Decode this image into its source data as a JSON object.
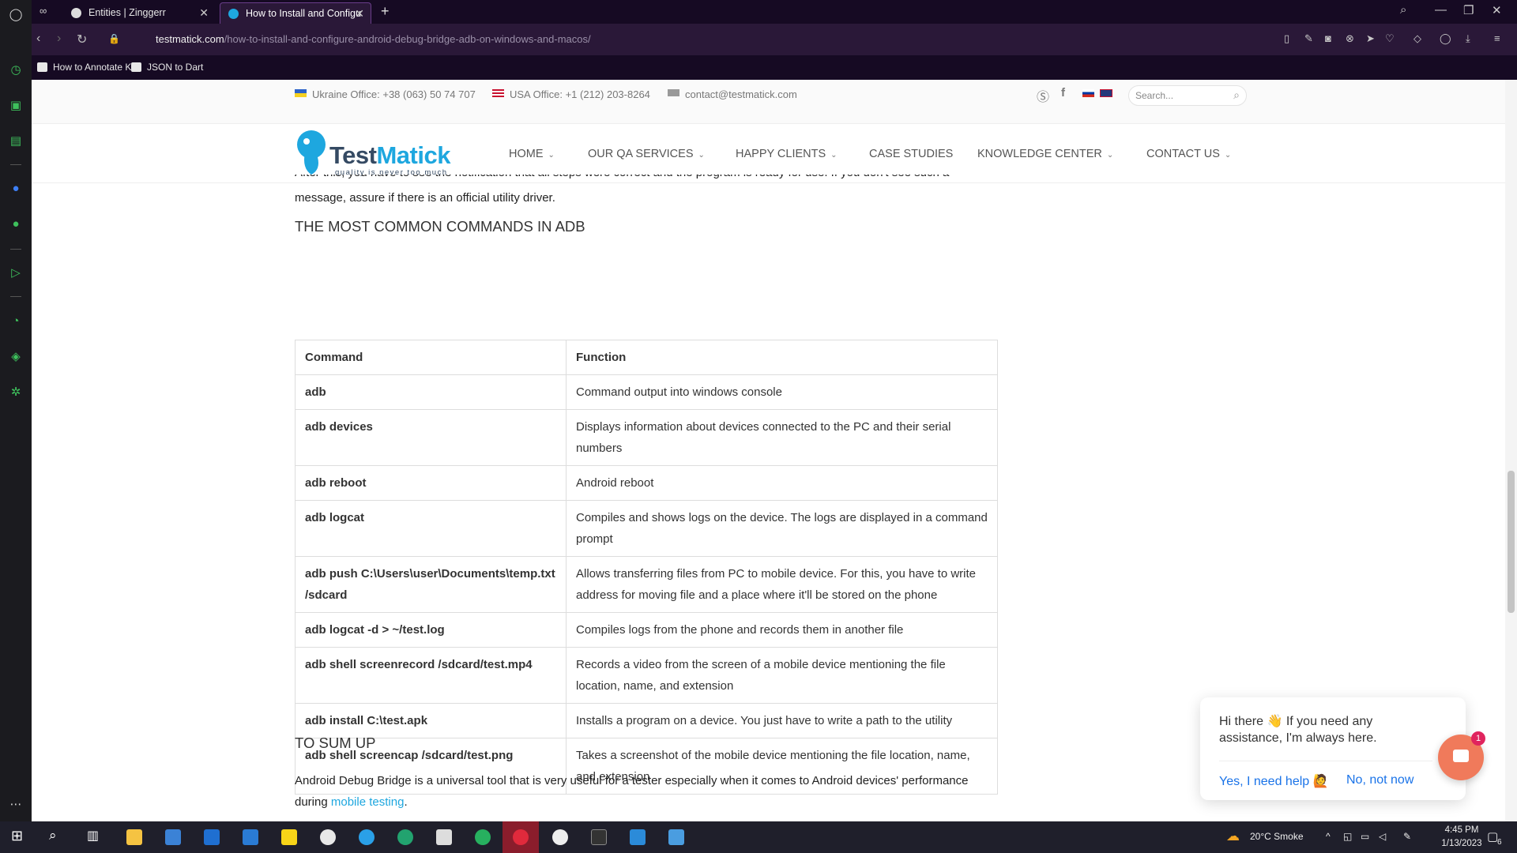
{
  "browser": {
    "tabs": [
      {
        "title": "Entities | Zinggerr",
        "active": false
      },
      {
        "title": "How to Install and Configu",
        "active": true
      }
    ],
    "url_domain": "testmatick.com",
    "url_path": "/how-to-install-and-configure-android-debug-bridge-adb-on-windows-and-macos/",
    "bookmarks": [
      "How to Annotate K...",
      "JSON to Dart"
    ]
  },
  "site": {
    "top_info": {
      "ukraine": "Ukraine Office: +38 (063) 50 74 707",
      "usa": "USA Office: +1 (212) 203-8264",
      "email": "contact@testmatick.com"
    },
    "search_placeholder": "Search...",
    "logo": {
      "test": "Test",
      "matick": "Matick",
      "slogan": "quality is never too much"
    },
    "menu": [
      {
        "label": "HOME",
        "has_dropdown": true
      },
      {
        "label": "OUR QA SERVICES",
        "has_dropdown": true
      },
      {
        "label": "HAPPY CLIENTS",
        "has_dropdown": true
      },
      {
        "label": "CASE STUDIES",
        "has_dropdown": false
      },
      {
        "label": "KNOWLEDGE CENTER",
        "has_dropdown": true
      },
      {
        "label": "CONTACT US",
        "has_dropdown": true
      }
    ]
  },
  "article": {
    "partial_text": "After this, you have to see the notification that all steps were correct and the program is ready for use. If you don't see such a",
    "partial_text_2": "message, assure if there is an official utility driver.",
    "heading_commands": "THE MOST COMMON COMMANDS IN ADB",
    "table_headers": [
      "Command",
      "Function"
    ],
    "table_rows": [
      {
        "command": "adb",
        "function": "Command output into windows console"
      },
      {
        "command": "adb devices",
        "function": "Displays information about devices connected to the PC and their serial numbers"
      },
      {
        "command": "adb reboot",
        "function": "Android reboot"
      },
      {
        "command": "adb logcat",
        "function": "Compiles and shows logs on the device. The logs are displayed in a command prompt"
      },
      {
        "command": "adb push C:\\Users\\user\\Documents\\temp.txt /sdcard",
        "function": "Allows transferring files from PC to mobile device. For this, you have to write address for moving file and a place where it'll be stored on the phone"
      },
      {
        "command": "adb logcat -d > ~/test.log",
        "function": "Compiles logs from the phone and records them in another file"
      },
      {
        "command": "adb shell screenrecord /sdcard/test.mp4",
        "function": "Records a video from the screen of a mobile device mentioning the file location, name, and extension"
      },
      {
        "command": "adb install C:\\test.apk",
        "function": "Installs a program on a device. You just have to write a path to the utility"
      },
      {
        "command": "adb shell screencap /sdcard/test.png",
        "function": "Takes a screenshot of the mobile device mentioning the file location, name, and extension"
      }
    ],
    "heading_sumup": "TO SUM UP",
    "final_text": "Android Debug Bridge is a universal tool that is very useful for a tester especially when it comes to Android devices' performance during ",
    "final_link": "mobile testing",
    "final_end": "."
  },
  "chat": {
    "message": "Hi there 👋 If you need any assistance, I'm always here.",
    "yes": "Yes, I need help 🙋",
    "no": "No, not now",
    "badge": "1"
  },
  "taskbar": {
    "weather": "20°C  Smoke",
    "time": "4:45 PM",
    "date": "1/13/2023",
    "notif": "6"
  },
  "colors": {
    "accent": "#1ea7df",
    "brand_dark": "#354a63",
    "chat": "#f07a5b",
    "sidebar_icon": "#3ec05c"
  }
}
